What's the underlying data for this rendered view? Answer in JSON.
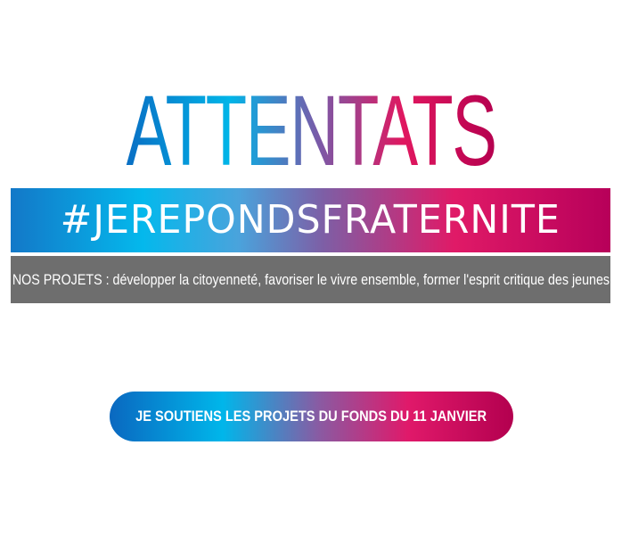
{
  "headline": {
    "text": "ATTENTATS"
  },
  "banner": {
    "hashtag": "#JEREPONDSFRATERNITE"
  },
  "projects": {
    "text": "NOS PROJETS : développer la citoyenneté, favoriser le vivre ensemble, former l'esprit critique des jeunes"
  },
  "cta": {
    "label": "JE SOUTIENS LES PROJETS DU FONDS DU 11 JANVIER"
  },
  "colors": {
    "blue": "#0a6fc4",
    "cyan": "#00b5e8",
    "purple": "#7d5fa6",
    "pink": "#e01a67",
    "magenta": "#b5004f",
    "gray_strip": "#6e6e6e",
    "background": "#ffffff"
  }
}
